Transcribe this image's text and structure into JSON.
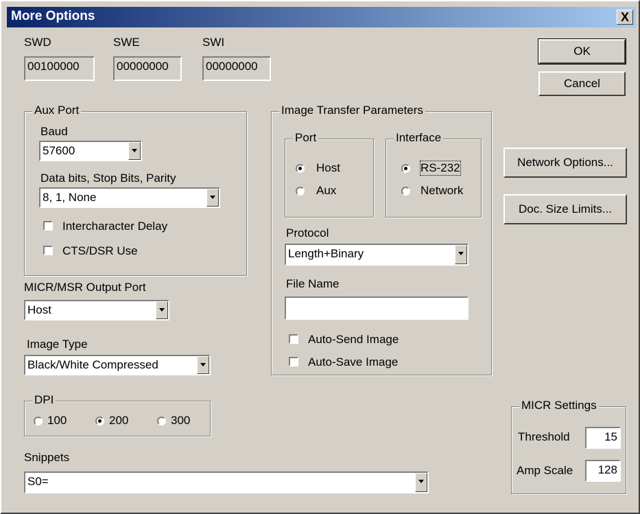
{
  "window": {
    "title": "More Options",
    "close_label": "X"
  },
  "registers": {
    "swd": {
      "label": "SWD",
      "value": "00100000"
    },
    "swe": {
      "label": "SWE",
      "value": "00000000"
    },
    "swi": {
      "label": "SWI",
      "value": "00000000"
    }
  },
  "buttons": {
    "ok": "OK",
    "cancel": "Cancel",
    "network_options": "Network Options...",
    "doc_size_limits": "Doc. Size Limits..."
  },
  "aux_port": {
    "title": "Aux Port",
    "baud_label": "Baud",
    "baud_value": "57600",
    "format_label": "Data bits, Stop Bits, Parity",
    "format_value": "8, 1, None",
    "interchar_delay": {
      "label": "Intercharacter Delay",
      "checked": false
    },
    "cts_dsr": {
      "label": "CTS/DSR Use",
      "checked": false
    }
  },
  "micr_output": {
    "label": "MICR/MSR Output Port",
    "value": "Host"
  },
  "image_type": {
    "label": "Image Type",
    "value": "Black/White Compressed"
  },
  "dpi": {
    "title": "DPI",
    "options": [
      "100",
      "200",
      "300"
    ],
    "selected": "200"
  },
  "snippets": {
    "label": "Snippets",
    "value": "S0="
  },
  "image_transfer": {
    "title": "Image Transfer Parameters",
    "port": {
      "title": "Port",
      "options": [
        "Host",
        "Aux"
      ],
      "selected": "Host"
    },
    "interface": {
      "title": "Interface",
      "options": [
        "RS-232",
        "Network"
      ],
      "selected": "RS-232"
    },
    "protocol_label": "Protocol",
    "protocol_value": "Length+Binary",
    "file_name_label": "File Name",
    "file_name_value": "",
    "auto_send": {
      "label": "Auto-Send Image",
      "checked": false
    },
    "auto_save": {
      "label": "Auto-Save Image",
      "checked": false
    }
  },
  "micr_settings": {
    "title": "MICR Settings",
    "threshold_label": "Threshold",
    "threshold_value": "15",
    "amp_scale_label": "Amp Scale",
    "amp_scale_value": "128"
  },
  "colors": {
    "face": "#d4d0c8",
    "title_start": "#0b246a",
    "title_end": "#a6caf0"
  }
}
